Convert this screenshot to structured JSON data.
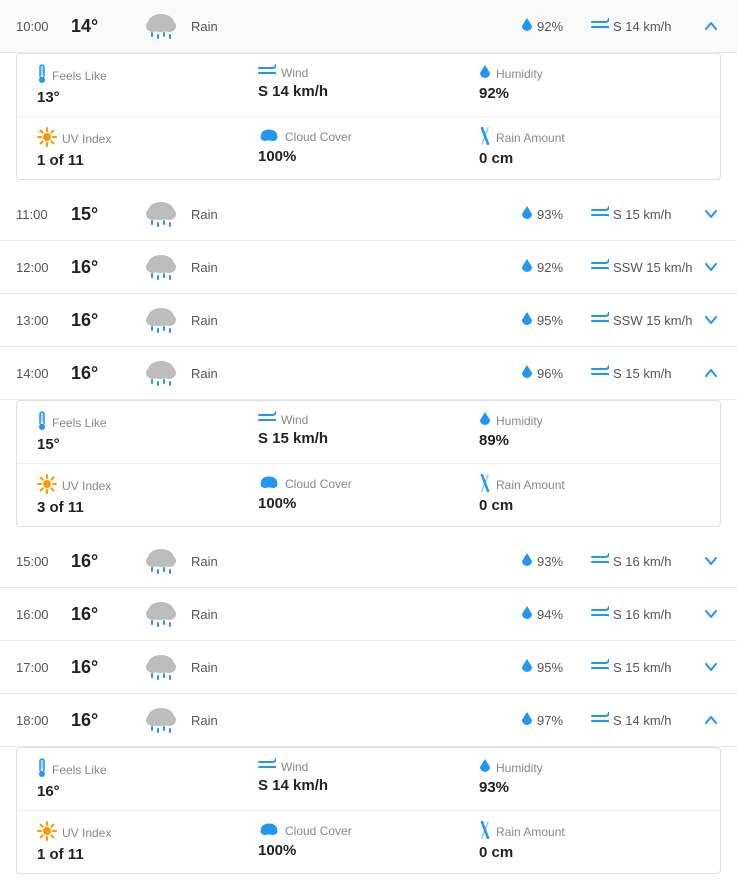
{
  "rows": [
    {
      "time": "10:00",
      "temp": "14°",
      "condition": "Rain",
      "humidity": "92%",
      "wind": "S 14 km/h",
      "chevron": "up",
      "expanded": true,
      "details": {
        "feels_like_label": "Feels Like",
        "feels_like": "13°",
        "wind_label": "Wind",
        "wind_detail": "S 14 km/h",
        "humidity_label": "Humidity",
        "humidity_detail": "92%",
        "uv_label": "UV Index",
        "uv": "1 of 11",
        "cloud_label": "Cloud Cover",
        "cloud": "100%",
        "rain_label": "Rain Amount",
        "rain": "0 cm"
      }
    },
    {
      "time": "11:00",
      "temp": "15°",
      "condition": "Rain",
      "humidity": "93%",
      "wind": "S 15 km/h",
      "chevron": "down",
      "expanded": false
    },
    {
      "time": "12:00",
      "temp": "16°",
      "condition": "Rain",
      "humidity": "92%",
      "wind": "SSW 15 km/h",
      "chevron": "down",
      "expanded": false
    },
    {
      "time": "13:00",
      "temp": "16°",
      "condition": "Rain",
      "humidity": "95%",
      "wind": "SSW 15 km/h",
      "chevron": "down",
      "expanded": false
    },
    {
      "time": "14:00",
      "temp": "16°",
      "condition": "Rain",
      "humidity": "96%",
      "wind": "S 15 km/h",
      "chevron": "up",
      "expanded": true,
      "details": {
        "feels_like_label": "Feels Like",
        "feels_like": "15°",
        "wind_label": "Wind",
        "wind_detail": "S 15 km/h",
        "humidity_label": "Humidity",
        "humidity_detail": "89%",
        "uv_label": "UV Index",
        "uv": "3 of 11",
        "cloud_label": "Cloud Cover",
        "cloud": "100%",
        "rain_label": "Rain Amount",
        "rain": "0 cm"
      }
    },
    {
      "time": "15:00",
      "temp": "16°",
      "condition": "Rain",
      "humidity": "93%",
      "wind": "S 16 km/h",
      "chevron": "down",
      "expanded": false
    },
    {
      "time": "16:00",
      "temp": "16°",
      "condition": "Rain",
      "humidity": "94%",
      "wind": "S 16 km/h",
      "chevron": "down",
      "expanded": false
    },
    {
      "time": "17:00",
      "temp": "16°",
      "condition": "Rain",
      "humidity": "95%",
      "wind": "S 15 km/h",
      "chevron": "down",
      "expanded": false
    },
    {
      "time": "18:00",
      "temp": "16°",
      "condition": "Rain",
      "humidity": "97%",
      "wind": "S 14 km/h",
      "chevron": "up",
      "expanded": true,
      "details": {
        "feels_like_label": "Feels Like",
        "feels_like": "16°",
        "wind_label": "Wind",
        "wind_detail": "S 14 km/h",
        "humidity_label": "Humidity",
        "humidity_detail": "93%",
        "uv_label": "UV Index",
        "uv": "1 of 11",
        "cloud_label": "Cloud Cover",
        "cloud": "100%",
        "rain_label": "Rain Amount",
        "rain": "0 cm"
      }
    }
  ]
}
